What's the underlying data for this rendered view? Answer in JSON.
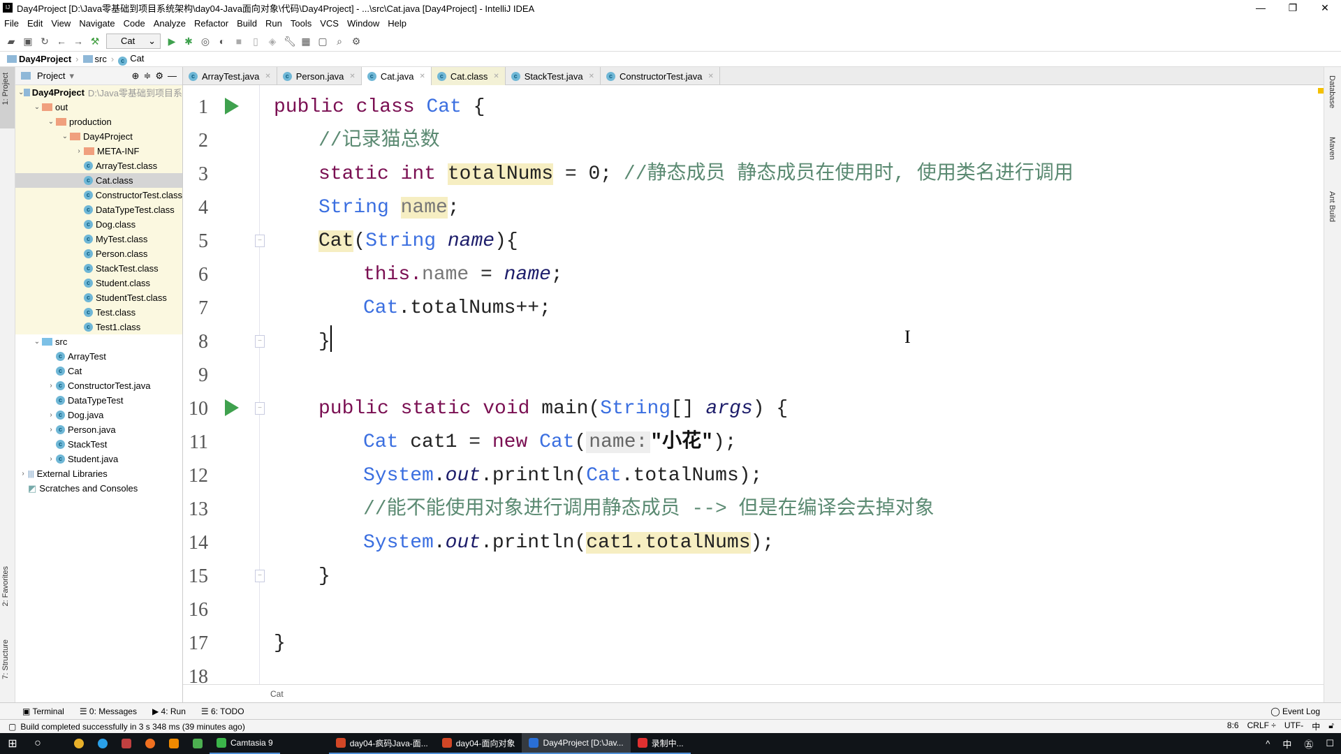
{
  "window": {
    "title": "Day4Project [D:\\Java零基础到项目系统架构\\day04-Java面向对象\\代码\\Day4Project] - ...\\src\\Cat.java [Day4Project] - IntelliJ IDEA",
    "minimize": "—",
    "restore": "❐",
    "close": "✕"
  },
  "menu": [
    "File",
    "Edit",
    "View",
    "Navigate",
    "Code",
    "Analyze",
    "Refactor",
    "Build",
    "Run",
    "Tools",
    "VCS",
    "Window",
    "Help"
  ],
  "toolbar": {
    "run_config": "Cat"
  },
  "breadcrumb": [
    "Day4Project",
    "src",
    "Cat"
  ],
  "left_strip": {
    "project": "1: Project",
    "favorites": "2: Favorites",
    "structure": "7: Structure"
  },
  "right_strip": {
    "database": "Database",
    "maven": "Maven",
    "ant": "Ant Build"
  },
  "project_panel": {
    "title": "Project",
    "tree": [
      {
        "label": "Day4Project",
        "path": "D:\\Java零基础到项目系",
        "depth": 0,
        "kind": "module",
        "expand": "v",
        "zone": "out"
      },
      {
        "label": "out",
        "depth": 1,
        "kind": "ofolder",
        "expand": "v",
        "zone": "out"
      },
      {
        "label": "production",
        "depth": 2,
        "kind": "ofolder",
        "expand": "v",
        "zone": "out"
      },
      {
        "label": "Day4Project",
        "depth": 3,
        "kind": "ofolder",
        "expand": "v",
        "zone": "out"
      },
      {
        "label": "META-INF",
        "depth": 4,
        "kind": "ofolder",
        "expand": ">",
        "zone": "out"
      },
      {
        "label": "ArrayTest.class",
        "depth": 4,
        "kind": "class",
        "zone": "out"
      },
      {
        "label": "Cat.class",
        "depth": 4,
        "kind": "class",
        "zone": "sel"
      },
      {
        "label": "ConstructorTest.class",
        "depth": 4,
        "kind": "class",
        "zone": "out"
      },
      {
        "label": "DataTypeTest.class",
        "depth": 4,
        "kind": "class",
        "zone": "out"
      },
      {
        "label": "Dog.class",
        "depth": 4,
        "kind": "class",
        "zone": "out"
      },
      {
        "label": "MyTest.class",
        "depth": 4,
        "kind": "class",
        "zone": "out"
      },
      {
        "label": "Person.class",
        "depth": 4,
        "kind": "class",
        "zone": "out"
      },
      {
        "label": "StackTest.class",
        "depth": 4,
        "kind": "class",
        "zone": "out"
      },
      {
        "label": "Student.class",
        "depth": 4,
        "kind": "class",
        "zone": "out"
      },
      {
        "label": "StudentTest.class",
        "depth": 4,
        "kind": "class",
        "zone": "out"
      },
      {
        "label": "Test.class",
        "depth": 4,
        "kind": "class",
        "zone": "out"
      },
      {
        "label": "Test1.class",
        "depth": 4,
        "kind": "class",
        "zone": "out"
      },
      {
        "label": "src",
        "depth": 1,
        "kind": "bfolder",
        "expand": "v"
      },
      {
        "label": "ArrayTest",
        "depth": 2,
        "kind": "class"
      },
      {
        "label": "Cat",
        "depth": 2,
        "kind": "class"
      },
      {
        "label": "ConstructorTest.java",
        "depth": 2,
        "kind": "class",
        "expand": ">"
      },
      {
        "label": "DataTypeTest",
        "depth": 2,
        "kind": "class"
      },
      {
        "label": "Dog.java",
        "depth": 2,
        "kind": "class",
        "expand": ">"
      },
      {
        "label": "Person.java",
        "depth": 2,
        "kind": "class",
        "expand": ">"
      },
      {
        "label": "StackTest",
        "depth": 2,
        "kind": "class"
      },
      {
        "label": "Student.java",
        "depth": 2,
        "kind": "class",
        "expand": ">"
      },
      {
        "label": "External Libraries",
        "depth": 0,
        "kind": "lib",
        "expand": ">"
      },
      {
        "label": "Scratches and Consoles",
        "depth": 0,
        "kind": "scratch"
      }
    ]
  },
  "tabs": [
    {
      "label": "ArrayTest.java",
      "state": ""
    },
    {
      "label": "Person.java",
      "state": ""
    },
    {
      "label": "Cat.java",
      "state": "active"
    },
    {
      "label": "Cat.class",
      "state": "cls"
    },
    {
      "label": "StackTest.java",
      "state": ""
    },
    {
      "label": "ConstructorTest.java",
      "state": ""
    }
  ],
  "editor": {
    "lines": [
      {
        "n": "1",
        "indent": 0,
        "run": true,
        "tokens": [
          [
            "public class ",
            "kw"
          ],
          [
            "Cat",
            "type"
          ],
          [
            " {",
            "plain"
          ]
        ]
      },
      {
        "n": "2",
        "indent": 1,
        "tokens": [
          [
            "//记录猫总数",
            "cm"
          ]
        ]
      },
      {
        "n": "3",
        "indent": 1,
        "tokens": [
          [
            "static int ",
            "kw"
          ],
          [
            "totalNums",
            "fld hl"
          ],
          [
            " = 0; ",
            "plain"
          ],
          [
            "//静态成员 静态成员在使用时, 使用类名进行调用",
            "cm"
          ]
        ]
      },
      {
        "n": "4",
        "indent": 1,
        "tokens": [
          [
            "String ",
            "type"
          ],
          [
            "name",
            "ifld hl"
          ],
          [
            ";",
            "plain"
          ]
        ]
      },
      {
        "n": "5",
        "indent": 1,
        "fold": true,
        "tokens": [
          [
            "Cat",
            "fld hl"
          ],
          [
            "(",
            "plain"
          ],
          [
            "String ",
            "type"
          ],
          [
            "name",
            "prm"
          ],
          [
            "){",
            "plain"
          ]
        ]
      },
      {
        "n": "6",
        "indent": 2,
        "tokens": [
          [
            "this.",
            "kw"
          ],
          [
            "name",
            "ifld"
          ],
          [
            " = ",
            "plain"
          ],
          [
            "name",
            "prm"
          ],
          [
            ";",
            "plain"
          ]
        ]
      },
      {
        "n": "7",
        "indent": 2,
        "tokens": [
          [
            "Cat",
            "type"
          ],
          [
            ".totalNums++;",
            "plain"
          ]
        ]
      },
      {
        "n": "8",
        "indent": 1,
        "fold": true,
        "caret": true,
        "tokens": [
          [
            "}",
            "plain"
          ]
        ]
      },
      {
        "n": "9",
        "indent": 0,
        "tokens": []
      },
      {
        "n": "10",
        "indent": 1,
        "run": true,
        "fold": true,
        "tokens": [
          [
            "public static void ",
            "kw"
          ],
          [
            "main(",
            "plain"
          ],
          [
            "String",
            "type"
          ],
          [
            "[] ",
            "plain"
          ],
          [
            "args",
            "prm"
          ],
          [
            ") {",
            "plain"
          ]
        ]
      },
      {
        "n": "11",
        "indent": 2,
        "tokens": [
          [
            "Cat ",
            "type"
          ],
          [
            "cat1 = ",
            "plain"
          ],
          [
            "new ",
            "kw"
          ],
          [
            "Cat",
            "type"
          ],
          [
            "(",
            "plain"
          ],
          [
            "name:",
            "hint"
          ],
          [
            "\"小花\"",
            "str"
          ],
          [
            ");",
            "plain"
          ]
        ]
      },
      {
        "n": "12",
        "indent": 2,
        "tokens": [
          [
            "System",
            "type"
          ],
          [
            ".",
            "plain"
          ],
          [
            "out",
            "prm"
          ],
          [
            ".println(",
            "plain"
          ],
          [
            "Cat",
            "type"
          ],
          [
            ".totalNums);",
            "plain"
          ]
        ]
      },
      {
        "n": "13",
        "indent": 2,
        "tokens": [
          [
            "//能不能使用对象进行调用静态成员 --> 但是在编译会去掉对象",
            "cm"
          ]
        ]
      },
      {
        "n": "14",
        "indent": 2,
        "tokens": [
          [
            "System",
            "type"
          ],
          [
            ".",
            "plain"
          ],
          [
            "out",
            "prm"
          ],
          [
            ".println(",
            "plain"
          ],
          [
            "cat1.totalNums",
            "fld hl"
          ],
          [
            ");",
            "plain"
          ]
        ]
      },
      {
        "n": "15",
        "indent": 1,
        "fold": true,
        "tokens": [
          [
            "}",
            "plain"
          ]
        ]
      },
      {
        "n": "16",
        "indent": 0,
        "tokens": []
      },
      {
        "n": "17",
        "indent": 0,
        "tokens": [
          [
            "}",
            "plain"
          ]
        ]
      },
      {
        "n": "18",
        "indent": 0,
        "tokens": []
      }
    ],
    "breadcrumb": "Cat"
  },
  "tool_windows": {
    "terminal": "Terminal",
    "messages": "0: Messages",
    "run": "4: Run",
    "todo": "6: TODO",
    "event_log": "Event Log"
  },
  "status": {
    "message": "Build completed successfully in 3 s 348 ms (39 minutes ago)",
    "position": "8:6",
    "line_sep": "CRLF ÷",
    "encoding": "UTF-",
    "ime": "中"
  },
  "taskbar": {
    "items": [
      {
        "label": "Camtasia 9",
        "color": "#3bb54a"
      },
      {
        "label": "day04-疯码Java-面...",
        "color": "#d24726"
      },
      {
        "label": "day04-面向对象",
        "color": "#d24726"
      },
      {
        "label": "Day4Project [D:\\Jav...",
        "color": "#2a6fd6",
        "active": true
      },
      {
        "label": "录制中...",
        "color": "#e03030"
      }
    ],
    "tray": [
      "^",
      "中",
      "㊄",
      "☐"
    ]
  }
}
